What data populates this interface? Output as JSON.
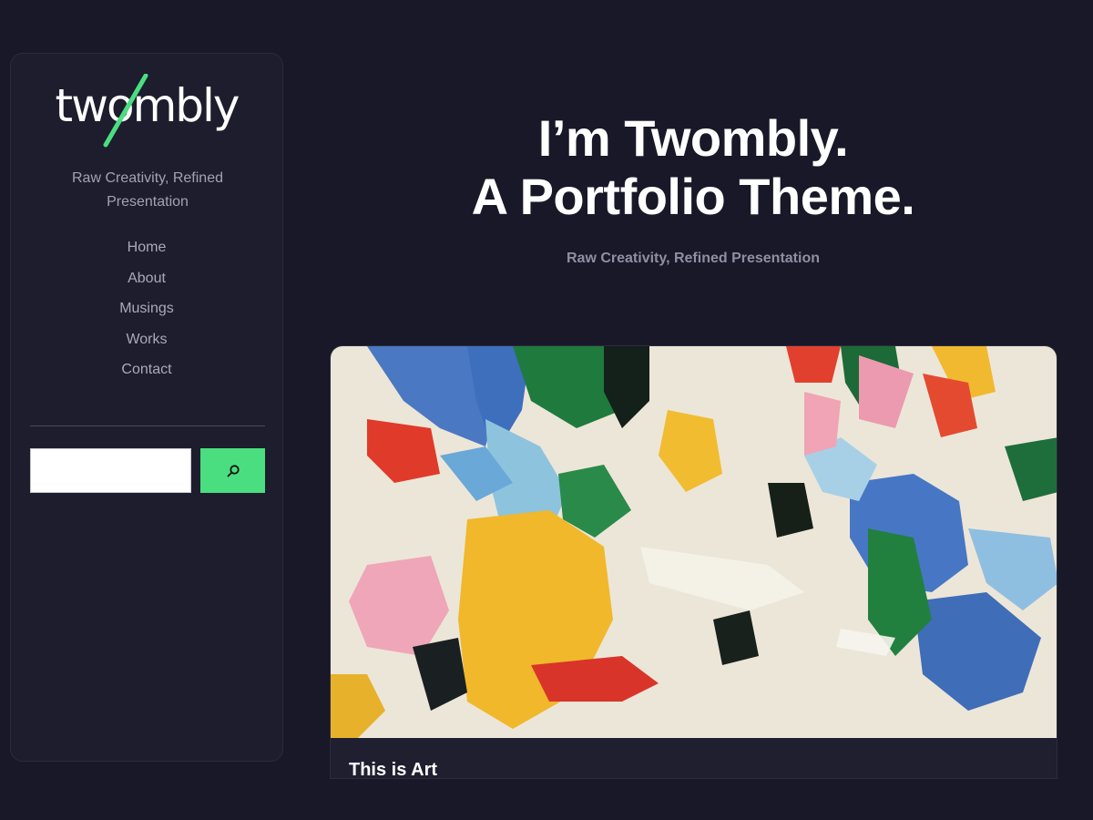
{
  "site": {
    "logo_text": "twombly",
    "tagline": "Raw Creativity, Refined Presentation"
  },
  "nav": {
    "items": [
      {
        "label": "Home"
      },
      {
        "label": "About"
      },
      {
        "label": "Musings"
      },
      {
        "label": "Works"
      },
      {
        "label": "Contact"
      }
    ]
  },
  "search": {
    "value": "",
    "button_icon": "search-icon"
  },
  "hero": {
    "title_line1": "I’m Twombly.",
    "title_line2": "A Portfolio Theme.",
    "subtitle": "Raw Creativity, Refined Presentation"
  },
  "featured": {
    "title": "This is Art",
    "image": "abstract-painting"
  },
  "colors": {
    "background": "#181828",
    "sidebar": "#1d1d2d",
    "accent": "#4ade80",
    "muted_text": "#a2a2b4"
  }
}
